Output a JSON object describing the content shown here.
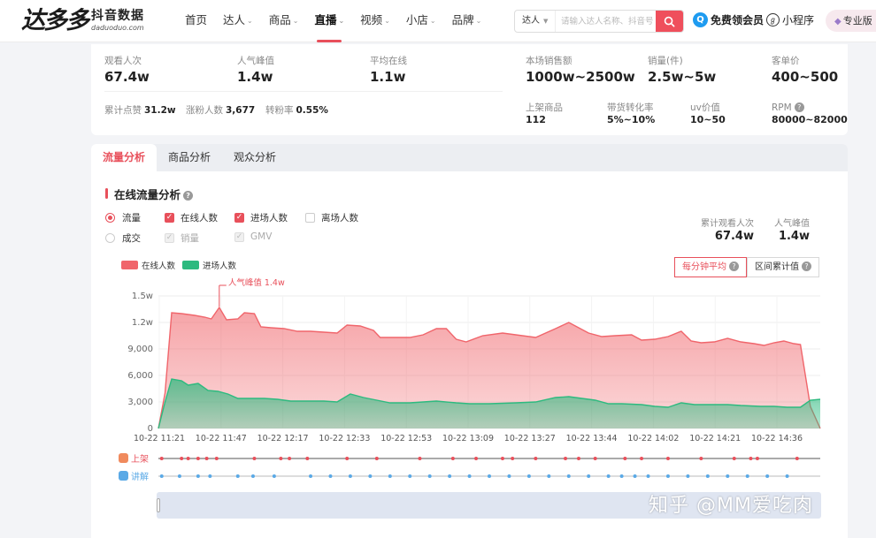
{
  "brand": {
    "logo_mark": "达多多",
    "name": "抖音数据",
    "domain": "daduoduo.com"
  },
  "nav": [
    {
      "label": "首页",
      "caret": false
    },
    {
      "label": "达人",
      "caret": true
    },
    {
      "label": "商品",
      "caret": true
    },
    {
      "label": "直播",
      "caret": true,
      "active": true
    },
    {
      "label": "视频",
      "caret": true
    },
    {
      "label": "小店",
      "caret": true
    },
    {
      "label": "品牌",
      "caret": true
    }
  ],
  "search": {
    "type": "达人",
    "placeholder": "请输入达人名称、抖音号"
  },
  "header_links": {
    "vip": "免费领会员",
    "mini": "小程序",
    "pro": "专业版"
  },
  "stats": {
    "viewers": {
      "label": "观看人次",
      "value": "67.4w"
    },
    "peak": {
      "label": "人气峰值",
      "value": "1.4w"
    },
    "avg_online": {
      "label": "平均在线",
      "value": "1.1w"
    },
    "likes": {
      "label": "累计点赞",
      "value": "31.2w"
    },
    "new_fans": {
      "label": "涨粉人数",
      "value": "3,677"
    },
    "conversion": {
      "label": "转粉率",
      "value": "0.55%"
    },
    "sales_amount": {
      "label": "本场销售额",
      "value": "1000w~2500w"
    },
    "sales_count": {
      "label": "销量(件)",
      "value": "2.5w~5w"
    },
    "unit_price": {
      "label": "客单价",
      "value": "400~500"
    },
    "listed_goods": {
      "label": "上架商品",
      "value": "112"
    },
    "goods_conversion": {
      "label": "带货转化率",
      "value": "5%~10%"
    },
    "uv_value": {
      "label": "uv价值",
      "value": "10~50"
    },
    "rpm": {
      "label": "RPM",
      "value": "80000~82000"
    }
  },
  "tabs": [
    "流量分析",
    "商品分析",
    "观众分析"
  ],
  "section_title": "在线流量分析",
  "options": {
    "row1": [
      {
        "kind": "radio",
        "label": "流量",
        "checked": true
      },
      {
        "kind": "check",
        "label": "在线人数",
        "checked": true
      },
      {
        "kind": "check",
        "label": "进场人数",
        "checked": true
      },
      {
        "kind": "check",
        "label": "离场人数",
        "checked": false
      }
    ],
    "row2": [
      {
        "kind": "radio",
        "label": "成交",
        "checked": false
      },
      {
        "kind": "check",
        "label": "销量",
        "checked": true,
        "disabled": true
      },
      {
        "kind": "check",
        "label": "GMV",
        "checked": true,
        "disabled": true
      }
    ]
  },
  "right_stats": {
    "total_viewers": {
      "label": "累计观看人次",
      "value": "67.4w"
    },
    "peak": {
      "label": "人气峰值",
      "value": "1.4w"
    }
  },
  "segmented": {
    "per_minute": "每分钟平均",
    "cumulative": "区间累计值"
  },
  "event_rows": {
    "listing": "上架",
    "explain": "讲解"
  },
  "watermark": "知乎 @MM爱吃肉",
  "colors": {
    "accent": "#e8505b",
    "online": "#f0656b",
    "entry": "#2dba7f",
    "explain": "#5aa9e6"
  },
  "chart_data": {
    "type": "area",
    "ylim": [
      0,
      15000
    ],
    "yticks": [
      0,
      3000,
      6000,
      9000,
      12000,
      15000
    ],
    "ytick_labels": [
      "0",
      "3,000",
      "6,000",
      "9,000",
      "1.2w",
      "1.5w"
    ],
    "xtick_labels": [
      "10-22 11:21",
      "10-22 11:47",
      "10-22 12:17",
      "10-22 12:33",
      "10-22 12:53",
      "10-22 13:09",
      "10-22 13:27",
      "10-22 13:44",
      "10-22 14:02",
      "10-22 14:21",
      "10-22 14:36"
    ],
    "x_range": [
      0,
      100
    ],
    "annotation": {
      "text": "人气峰值 1.4w",
      "x": 9.2,
      "y": 13800
    },
    "series": [
      {
        "name": "在线人数",
        "color": "#f0656b",
        "points": [
          [
            0,
            0
          ],
          [
            1,
            4000
          ],
          [
            2,
            13100
          ],
          [
            3.5,
            13000
          ],
          [
            5.5,
            12800
          ],
          [
            7,
            12600
          ],
          [
            8,
            12400
          ],
          [
            9.2,
            13700
          ],
          [
            10.3,
            12300
          ],
          [
            12,
            12400
          ],
          [
            13,
            13100
          ],
          [
            14.5,
            13000
          ],
          [
            15.5,
            11500
          ],
          [
            17,
            11400
          ],
          [
            19,
            11300
          ],
          [
            21,
            11000
          ],
          [
            23,
            11000
          ],
          [
            25,
            10900
          ],
          [
            27,
            10800
          ],
          [
            28.5,
            11700
          ],
          [
            30.5,
            11600
          ],
          [
            32.5,
            11100
          ],
          [
            33.5,
            10300
          ],
          [
            36,
            10300
          ],
          [
            38,
            10300
          ],
          [
            40,
            10600
          ],
          [
            42,
            11300
          ],
          [
            43.5,
            11300
          ],
          [
            45,
            10100
          ],
          [
            46.5,
            9800
          ],
          [
            49,
            10500
          ],
          [
            52,
            10800
          ],
          [
            55,
            10500
          ],
          [
            57,
            10300
          ],
          [
            60,
            11300
          ],
          [
            62,
            12000
          ],
          [
            63.5,
            11400
          ],
          [
            65,
            10800
          ],
          [
            67,
            10400
          ],
          [
            69,
            10500
          ],
          [
            71.5,
            10600
          ],
          [
            73,
            10000
          ],
          [
            75,
            10100
          ],
          [
            77,
            10400
          ],
          [
            79,
            11000
          ],
          [
            80.5,
            9900
          ],
          [
            82,
            9700
          ],
          [
            84,
            9800
          ],
          [
            86,
            10200
          ],
          [
            88,
            9800
          ],
          [
            90,
            9600
          ],
          [
            91.5,
            9400
          ],
          [
            93,
            9700
          ],
          [
            94.5,
            9900
          ],
          [
            96,
            9600
          ],
          [
            97,
            9500
          ],
          [
            98.5,
            2500
          ],
          [
            100,
            0
          ]
        ]
      },
      {
        "name": "进场人数",
        "color": "#2dba7f",
        "points": [
          [
            0,
            0
          ],
          [
            1,
            3000
          ],
          [
            2,
            5600
          ],
          [
            3.5,
            5400
          ],
          [
            4.5,
            4900
          ],
          [
            6,
            5100
          ],
          [
            7.5,
            4300
          ],
          [
            9,
            4200
          ],
          [
            10.5,
            3900
          ],
          [
            12,
            3400
          ],
          [
            14,
            3400
          ],
          [
            16,
            3400
          ],
          [
            18,
            3300
          ],
          [
            20,
            3100
          ],
          [
            22,
            3100
          ],
          [
            25,
            3100
          ],
          [
            27,
            3000
          ],
          [
            29,
            3900
          ],
          [
            31,
            3500
          ],
          [
            33,
            3200
          ],
          [
            35,
            2900
          ],
          [
            38,
            2900
          ],
          [
            40,
            3000
          ],
          [
            42,
            3100
          ],
          [
            45,
            2900
          ],
          [
            47,
            2800
          ],
          [
            50,
            2800
          ],
          [
            54,
            2900
          ],
          [
            57,
            3000
          ],
          [
            60,
            3500
          ],
          [
            62,
            3600
          ],
          [
            64,
            3400
          ],
          [
            66,
            3200
          ],
          [
            68,
            2800
          ],
          [
            70,
            2800
          ],
          [
            73,
            2700
          ],
          [
            75,
            2500
          ],
          [
            77,
            2400
          ],
          [
            79,
            2900
          ],
          [
            81,
            2700
          ],
          [
            83,
            2700
          ],
          [
            86,
            2700
          ],
          [
            88,
            2600
          ],
          [
            91,
            2500
          ],
          [
            93,
            2500
          ],
          [
            95,
            2400
          ],
          [
            97,
            2400
          ],
          [
            98.5,
            3200
          ],
          [
            100,
            3300
          ]
        ]
      }
    ],
    "events": {
      "上架": [
        0.5,
        3.5,
        4.5,
        6,
        7.3,
        8.8,
        14.5,
        18.5,
        19.8,
        22.5,
        28.5,
        33,
        39.5,
        44.5,
        48,
        52,
        53.5,
        57,
        61.5,
        63.5,
        66,
        70.5,
        73,
        77,
        82,
        87,
        89.5,
        90.5,
        96.5
      ],
      "讲解": [
        0.5,
        3.2,
        6,
        7.8,
        12,
        14.3,
        17.5,
        23,
        26,
        29,
        32,
        35,
        38,
        41,
        44,
        47,
        50,
        53,
        56,
        59,
        62,
        65,
        68,
        70,
        72,
        74,
        77,
        80,
        83,
        86,
        89,
        92,
        95
      ]
    }
  }
}
